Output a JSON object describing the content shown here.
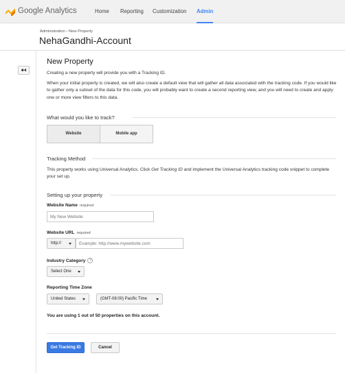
{
  "nav": {
    "brand": "Google Analytics",
    "items": [
      {
        "label": "Home"
      },
      {
        "label": "Reporting"
      },
      {
        "label": "Customization"
      },
      {
        "label": "Admin"
      }
    ],
    "active": "Admin",
    "logo_colors": [
      "#f9ab00",
      "#e37400"
    ],
    "accent": "#4285f4"
  },
  "header": {
    "breadcrumb": [
      "Administration",
      "New Property"
    ],
    "breadcrumb_sep": "›",
    "account_name": "NehaGandhi-Account"
  },
  "back_icon": "arrow-left-icon",
  "back_glyph": "↤",
  "page": {
    "title": "New Property",
    "intro1": "Creating a new property will provide you with a Tracking ID.",
    "intro2": "When your initial property is created, we will also create a default view that will gather all data associated with the tracking code. If you would like to gather only a subset of the data for this code, you will probably want to create a second reporting view, and you will need to create and apply one or more view filters to this data."
  },
  "track": {
    "heading": "What would you like to track?",
    "options": [
      "Website",
      "Mobile app"
    ],
    "selected": "Website"
  },
  "method": {
    "heading": "Tracking Method",
    "text_pre": "This property works using Universal Analytics. Click ",
    "text_em": "Get Tracking ID",
    "text_post": " and implement the Universal Analytics tracking code snippet to complete your set up."
  },
  "setup": {
    "heading": "Setting up your property",
    "website_name": {
      "label": "Website Name",
      "required": "required",
      "placeholder": "My New Website",
      "value": ""
    },
    "website_url": {
      "label": "Website URL",
      "required": "required",
      "protocol": "http://",
      "placeholder": "Example: http://www.mywebsite.com",
      "value": ""
    },
    "industry": {
      "label": "Industry Category",
      "help": "?",
      "value": "Select One"
    },
    "timezone": {
      "label": "Reporting Time Zone",
      "country": "United States",
      "zone": "(GMT-08:00) Pacific Time"
    }
  },
  "usage": "You are using 1 out of 50 properties on this account.",
  "buttons": {
    "primary": "Get Tracking ID",
    "cancel": "Cancel"
  }
}
